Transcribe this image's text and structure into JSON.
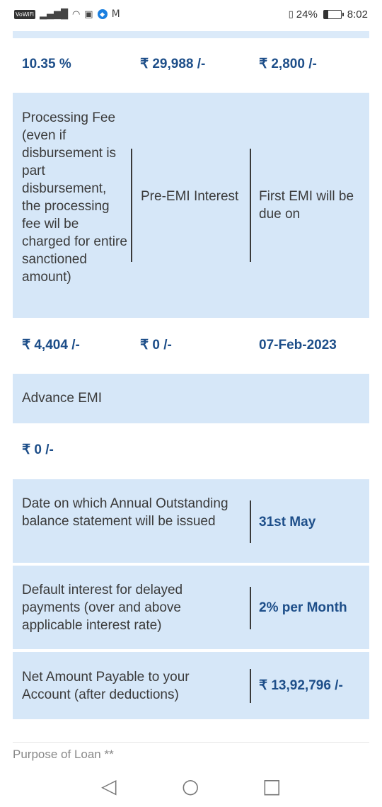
{
  "status": {
    "vowifi": "VoWiFi",
    "battery_text": "24%",
    "battery_fraction": 0.24,
    "time": "8:02"
  },
  "row1": {
    "rate": "10.35 %",
    "amount": "₹ 29,988 /-",
    "emi": "₹ 2,800 /-"
  },
  "labels1": {
    "fee": "Processing Fee (even if disbursement is part disbursement, the processing fee wil be charged for entire sanctioned amount)",
    "pre_emi": "Pre-EMI Interest",
    "first_emi": "First EMI will be due on"
  },
  "row2": {
    "fee": "₹ 4,404 /-",
    "pre_emi": "₹ 0 /-",
    "first_emi_date": "07-Feb-2023"
  },
  "labels2": {
    "advance": "Advance EMI"
  },
  "row3": {
    "advance": "₹ 0 /-"
  },
  "statement": {
    "label": "Date on which Annual Outstanding balance statement will be issued",
    "value": "31st May"
  },
  "default_interest": {
    "label": "Default interest for delayed payments (over and above applicable interest rate)",
    "value": "2% per Month"
  },
  "net_amount": {
    "label": "Net Amount Payable to your Account (after deductions)",
    "value": "₹ 13,92,796 /-"
  },
  "purpose": {
    "label": "Purpose of Loan **"
  },
  "nav": {
    "back": "◁",
    "home": "○",
    "recent": "□"
  }
}
